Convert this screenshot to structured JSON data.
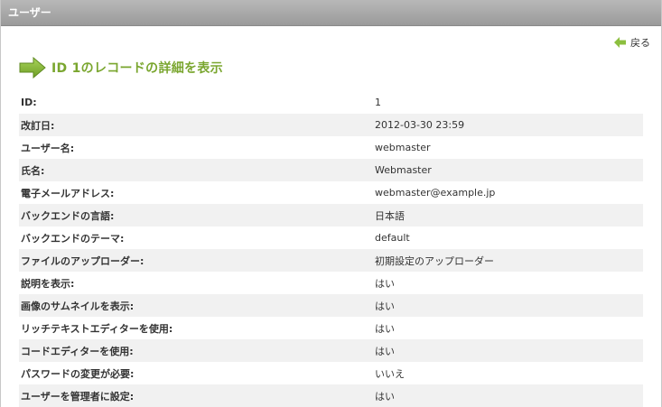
{
  "header": {
    "title": "ユーザー"
  },
  "toolbar": {
    "back_label": "戻る"
  },
  "page": {
    "title": "ID 1のレコードの詳細を表示"
  },
  "details": [
    {
      "label": "ID:",
      "value": "1"
    },
    {
      "label": "改訂日:",
      "value": "2012-03-30 23:59"
    },
    {
      "label": "ユーザー名:",
      "value": "webmaster"
    },
    {
      "label": "氏名:",
      "value": "Webmaster"
    },
    {
      "label": "電子メールアドレス:",
      "value": "webmaster@example.jp"
    },
    {
      "label": "バックエンドの言語:",
      "value": "日本語"
    },
    {
      "label": "バックエンドのテーマ:",
      "value": "default"
    },
    {
      "label": "ファイルのアップローダー:",
      "value": "初期設定のアップローダー"
    },
    {
      "label": "説明を表示:",
      "value": "はい"
    },
    {
      "label": "画像のサムネイルを表示:",
      "value": "はい"
    },
    {
      "label": "リッチテキストエディターを使用:",
      "value": "はい"
    },
    {
      "label": "コードエディターを使用:",
      "value": "はい"
    },
    {
      "label": "パスワードの変更が必要:",
      "value": "いいえ"
    },
    {
      "label": "ユーザーを管理者に設定:",
      "value": "はい"
    }
  ],
  "colors": {
    "accent": "#7aa62f",
    "header_bg": "#a6a6a6",
    "row_alt": "#f1f1f1"
  }
}
